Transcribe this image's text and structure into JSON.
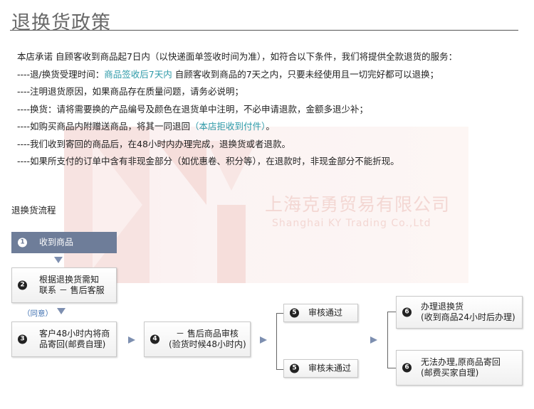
{
  "header": {
    "title": "退换货政策"
  },
  "policy": {
    "intro": "本店承诺 自顾客收到商品起7日内（以快递面单签收时间为准），如符合以下条件，我们将提供全款退货的服务：",
    "line1_prefix": "----退/换货受理时间：",
    "line1_highlight": "商品签收后7天内",
    "line1_suffix": " 自顾客收到商品的7天之内，只要未经使用且一切完好都可以退换；",
    "line2": "----注明退货原因，如果商品存在质量问题，请务必说明；",
    "line3": "----换货：请将需要换的产品编号及颜色在退货单中注明，不必申请退款，金额多退少补；",
    "line4_prefix": "----如购买商品内附赠送商品，将其一同退回",
    "line4_highlight": "（本店拒收到付件）",
    "line4_suffix": "。",
    "line5": "----我们收到寄回的商品后，在48小时内办理完成，退换货或者退款。",
    "line6": "----如果所支付的订单中含有非现金部分（如优惠卷、积分等），在退款时，非现金部分不能折现。"
  },
  "watermark": {
    "company_cn": "上海克勇贸易有限公司",
    "company_en": "Shanghai KY Trading Co.,Ltd"
  },
  "flow": {
    "title": "退换货流程",
    "agree_note": "（同意）",
    "steps": {
      "s1": {
        "num": "1",
        "text": "收到商品"
      },
      "s2": {
        "num": "2",
        "line1": "根据退换货需知",
        "line2": "联系 － 售后客服"
      },
      "s3": {
        "num": "3",
        "line1": "客户48小时内将商",
        "line2": "品寄回(邮费自理)"
      },
      "s4": {
        "num": "4",
        "line1": "－ 售后商品审核",
        "line2": "(验货时候48小时内)"
      },
      "s5a": {
        "num": "5",
        "text": "审核通过"
      },
      "s5b": {
        "num": "5",
        "text": "审核未通过"
      },
      "s6a": {
        "num": "6",
        "line1": "办理退换货",
        "line2": "(收到商品24小时后办理)"
      },
      "s6b": {
        "num": "6",
        "line1": "无法办理,原商品寄回",
        "line2": "(邮费买家自理)"
      }
    }
  },
  "colors": {
    "highlight": "#2d9aa8",
    "step1_bg": "#6e7d99",
    "arrow": "#7d8fb0",
    "note": "#3d6fb0"
  }
}
